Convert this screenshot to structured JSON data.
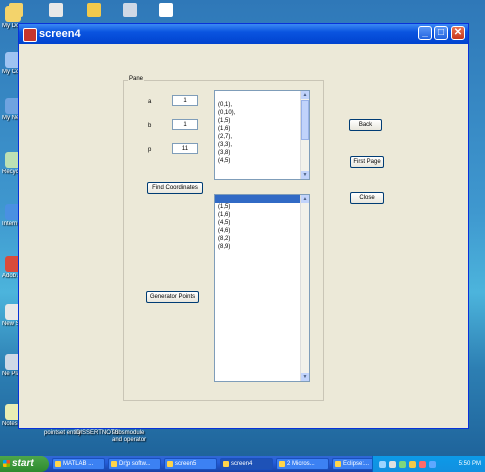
{
  "window": {
    "title": "screen4"
  },
  "panel": {
    "title": "Pane"
  },
  "fields": {
    "a": {
      "label": "a",
      "value": "1"
    },
    "b": {
      "label": "b",
      "value": "1"
    },
    "p": {
      "label": "p",
      "value": "11"
    }
  },
  "buttons": {
    "find_coordinates": "Find Coordinates",
    "generator_points": "Generator Points",
    "back": "Back",
    "first_page": "First Page",
    "close": "Close"
  },
  "coordinates_list": [
    "(0,1),",
    "(0,10),",
    "(1,5)",
    "(1,6)",
    "(2,7),",
    "(3,3),",
    "(3,8)",
    "(4,5)"
  ],
  "generator_list": [
    "",
    "(1,5)",
    "(1,6)",
    "(4,5)",
    "(4,6)",
    "(8,2)",
    "(8,9)"
  ],
  "desktop": {
    "icons": [
      {
        "name": "my-documents-icon",
        "label": "My Docum",
        "color": "#f3d36b"
      },
      {
        "name": "my-computer-icon",
        "label": "My Compu",
        "color": "#9ec3f2"
      },
      {
        "name": "network-places-icon",
        "label": "My Netw Place",
        "color": "#6fa3e0"
      },
      {
        "name": "recycle-bin-icon",
        "label": "Recycle",
        "color": "#bde0b4"
      },
      {
        "name": "internet-explorer-icon",
        "label": "Intern Explor",
        "color": "#4a90e2"
      },
      {
        "name": "adobe-icon",
        "label": "Adob Acrob",
        "color": "#d94b3a"
      },
      {
        "name": "new-start-icon",
        "label": "New Start",
        "color": "#e8e8e8"
      },
      {
        "name": "network-icon",
        "label": "Ne Place",
        "color": "#cfd8e6"
      },
      {
        "name": "notepad-icon",
        "label": "Notes m Entr",
        "color": "#e9edb4"
      }
    ],
    "bottom_labels": [
      "pointset entity",
      "DISSERTNOTS",
      "subsmodule and operator"
    ]
  },
  "taskbar": {
    "start_label": "start",
    "tasks": [
      "MATLAB ...",
      "Dr¦p softw...",
      "screen5",
      "screen4",
      "2 Micros...",
      "Eclipse:..."
    ],
    "active_task_index": 3,
    "clock": "5:50 PM"
  },
  "colors": {
    "title_blue": "#0a54e0",
    "window_bg": "#ece9d8",
    "selection": "#316ac5"
  }
}
